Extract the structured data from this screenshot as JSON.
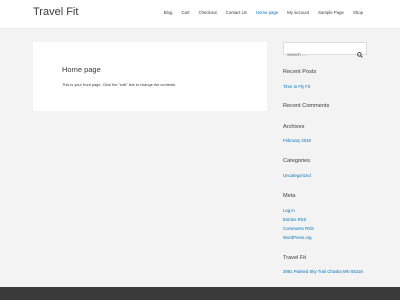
{
  "header": {
    "site_title": "Travel Fit",
    "nav": [
      {
        "label": "Blog"
      },
      {
        "label": "Cart"
      },
      {
        "label": "Checkout"
      },
      {
        "label": "Contact Us"
      },
      {
        "label": "Home page",
        "active": true
      },
      {
        "label": "My account"
      },
      {
        "label": "Sample Page"
      },
      {
        "label": "Shop"
      }
    ]
  },
  "main": {
    "title": "Home page",
    "body": "This is your front page. Click the \"edit\" link to change the contents."
  },
  "sidebar": {
    "search_placeholder": "Search …",
    "recent_posts": {
      "title": "Recent Posts",
      "items": [
        "Time to Fly Fit"
      ]
    },
    "recent_comments": {
      "title": "Recent Comments"
    },
    "archives": {
      "title": "Archives",
      "items": [
        "February 2018"
      ]
    },
    "categories": {
      "title": "Categories",
      "items": [
        "Uncategorized"
      ]
    },
    "meta": {
      "title": "Meta",
      "items": [
        "Log in",
        "Entries RSS",
        "Comments RSS",
        "WordPress.org"
      ],
      "rss_abbr": "RSS"
    },
    "contact": {
      "title": "Travel Fit",
      "address": "3981 Painted Sky Trail Chaska MN 55318"
    }
  },
  "colors": {
    "accent": "#0274be",
    "text": "#3a3a3a",
    "background": "#f3f3f3",
    "footer": "#3a3a3a"
  }
}
